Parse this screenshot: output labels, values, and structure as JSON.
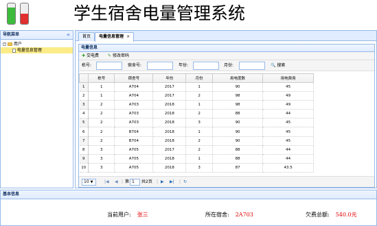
{
  "header": {
    "title": "学生宿舍电量管理系统",
    "logo_colors": {
      "battery_green": "#3dbb3d",
      "battery_red": "#e03030"
    }
  },
  "west": {
    "title": "导航菜单",
    "collapse_icon": "«",
    "tree": {
      "root": "用户",
      "child": "电量信息管理"
    }
  },
  "tabs": [
    {
      "label": "首页"
    },
    {
      "label": "电量信息管理",
      "close": "×"
    }
  ],
  "panel": {
    "title": "电量信息"
  },
  "toolbar": {
    "pay_label": "交电费",
    "edit_label": "修改密码"
  },
  "search": {
    "stu_label": "栋号:",
    "dorm_label": "宿舍号:",
    "year_label": "年份:",
    "month_label": "月份:",
    "button_label": "搜索"
  },
  "grid": {
    "columns": [
      "栋号",
      "宿舍号",
      "年份",
      "月份",
      "用电度数",
      "用电费用"
    ],
    "rows": [
      [
        "1",
        "1",
        "A704",
        "2017",
        "1",
        "90",
        "45"
      ],
      [
        "2",
        "1",
        "A704",
        "2017",
        "2",
        "98",
        "49"
      ],
      [
        "3",
        "2",
        "A703",
        "2018",
        "1",
        "98",
        "49"
      ],
      [
        "4",
        "2",
        "A703",
        "2018",
        "2",
        "88",
        "44"
      ],
      [
        "5",
        "2",
        "A703",
        "2018",
        "3",
        "90",
        "45"
      ],
      [
        "6",
        "2",
        "B704",
        "2018",
        "1",
        "90",
        "45"
      ],
      [
        "7",
        "2",
        "B704",
        "2018",
        "2",
        "90",
        "45"
      ],
      [
        "8",
        "3",
        "A705",
        "2017",
        "2",
        "88",
        "44"
      ],
      [
        "9",
        "3",
        "A705",
        "2018",
        "1",
        "88",
        "44"
      ],
      [
        "10",
        "3",
        "A705",
        "2018",
        "3",
        "87",
        "43.5"
      ]
    ]
  },
  "pager": {
    "page_size": "10",
    "page_prefix": "第",
    "page_num": "1",
    "page_total": "共2页"
  },
  "south": {
    "title": "基本信息",
    "user_label": "当前用户:",
    "user_value": "张三",
    "dorm_label": "所在宿舍:",
    "dorm_value": "2A703",
    "owe_label": "欠费总额:",
    "owe_value": "540.0元"
  }
}
